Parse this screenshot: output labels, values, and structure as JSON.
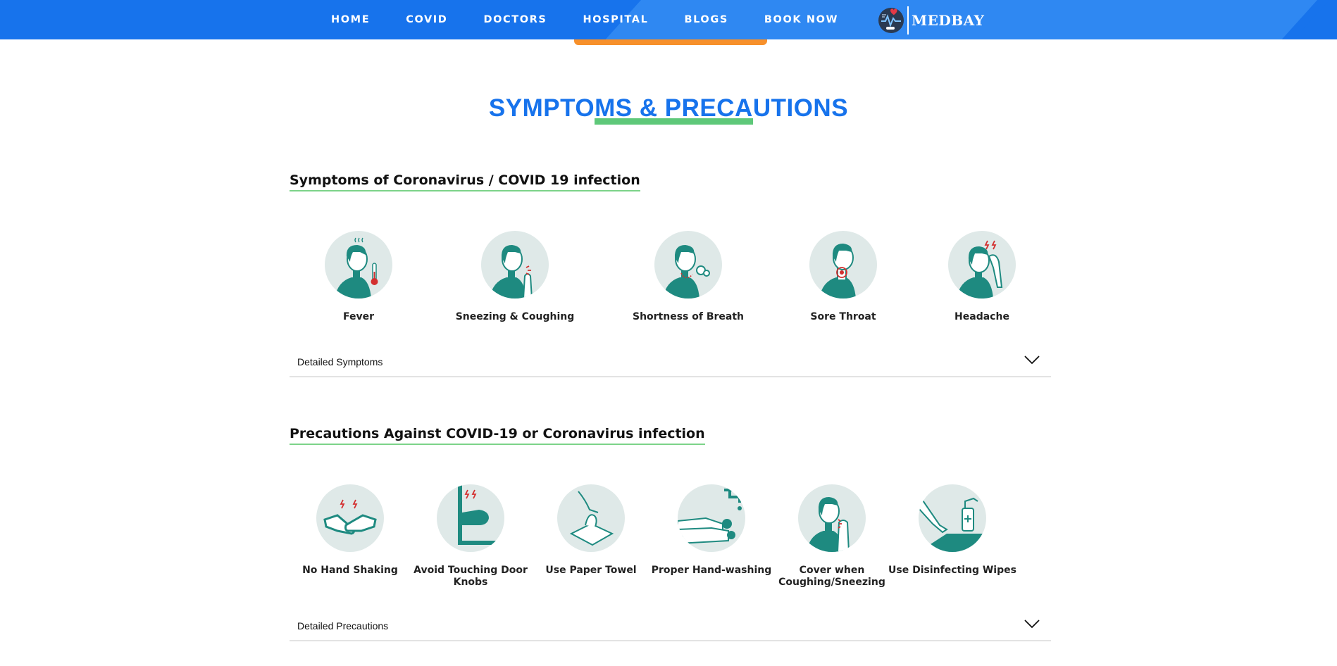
{
  "nav": {
    "links": [
      "HOME",
      "COVID",
      "DOCTORS",
      "HOSPITAL",
      "BLOGS",
      "BOOK NOW"
    ],
    "brand": "MEDBAY"
  },
  "section_title": "SYMPTOMS & PRECAUTIONS",
  "symptoms": {
    "heading": "Symptoms of Coronavirus / COVID 19 infection",
    "items": [
      "Fever",
      "Sneezing & Coughing",
      "Shortness of Breath",
      "Sore Throat",
      "Headache"
    ],
    "accordion": "Detailed Symptoms"
  },
  "precautions": {
    "heading": "Precautions Against COVID-19 or Coronavirus infection",
    "items": [
      "No Hand Shaking",
      "Avoid Touching Door Knobs",
      "Use Paper Towel",
      "Proper Hand-washing",
      "Cover when Coughing/Sneezing",
      "Use Disinfecting Wipes"
    ],
    "accordion": "Detailed Precautions"
  },
  "colors": {
    "nav": "#1773ec",
    "accent": "#f7902b",
    "title": "#1773ec",
    "underline": "#5ec879",
    "teal": "#1e8a80"
  }
}
